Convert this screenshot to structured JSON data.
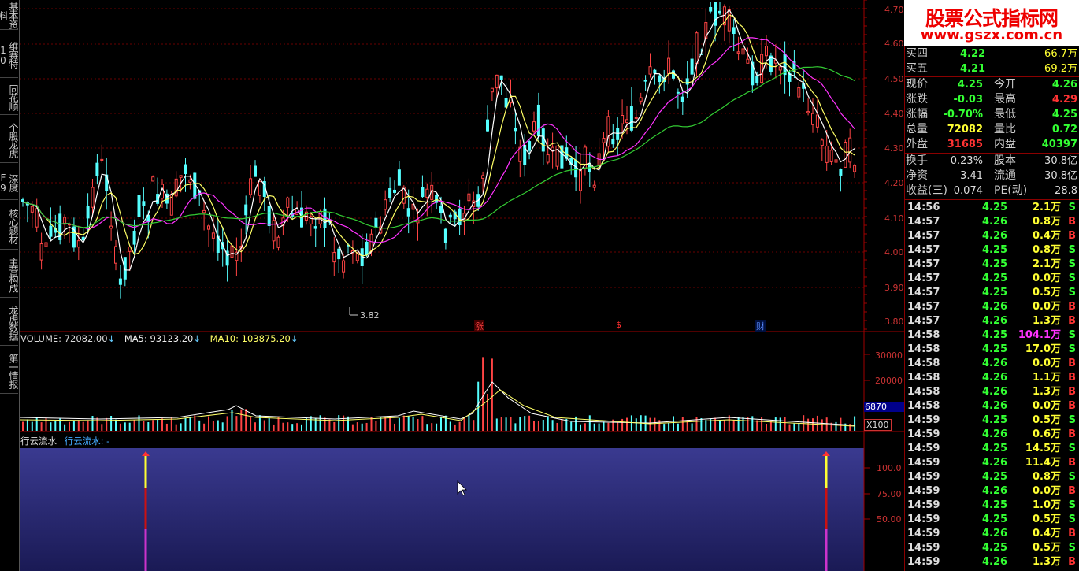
{
  "left_tabs": [
    {
      "label": "基本资料"
    },
    {
      "label": "维赛特10"
    },
    {
      "label": "同花顺"
    },
    {
      "label": "个股龙虎"
    },
    {
      "label": "深度F9"
    },
    {
      "label": "核心题材"
    },
    {
      "label": "主营构成"
    },
    {
      "label": "龙虎数据"
    },
    {
      "label": "第一情报"
    }
  ],
  "logo": {
    "title": "股票公式指标网",
    "url": "www.gszx.com.cn"
  },
  "price_axis": [
    "4.70",
    "4.60",
    "4.50",
    "4.40",
    "4.30",
    "4.20",
    "4.10",
    "4.00",
    "3.90",
    "3.80"
  ],
  "low_marker": "3.82",
  "event_markers": [
    {
      "label": "涨",
      "color": "#ff4444"
    },
    {
      "label": "$",
      "color": "#ff3030"
    },
    {
      "label": "财",
      "color": "#5a8cff"
    }
  ],
  "volume_header": {
    "volume": "VOLUME: 72082.00",
    "ma5": "MA5: 93123.20",
    "ma10": "MA10: 103875.20",
    "arrow": "↓"
  },
  "volume_axis": [
    "30000",
    "20000"
  ],
  "volume_box": "6870",
  "volume_unit": "X100",
  "indicator": {
    "name": "行云流水",
    "label": "行云流水: -"
  },
  "indicator_axis": [
    "100.0",
    "75.00",
    "50.00"
  ],
  "quote": {
    "ask_rows": [
      {
        "label": "买四",
        "price": "4.22",
        "vol": "66.7万"
      },
      {
        "label": "买五",
        "price": "4.21",
        "vol": "69.2万"
      }
    ],
    "stats": [
      {
        "l1": "现价",
        "v1": "4.25",
        "c1": "#33ff33",
        "l2": "今开",
        "v2": "4.26",
        "c2": "#33ff33"
      },
      {
        "l1": "涨跌",
        "v1": "-0.03",
        "c1": "#33ff33",
        "l2": "最高",
        "v2": "4.29",
        "c2": "#ff3333"
      },
      {
        "l1": "涨幅",
        "v1": "-0.70%",
        "c1": "#33ff33",
        "l2": "最低",
        "v2": "4.25",
        "c2": "#33ff33"
      },
      {
        "l1": "总量",
        "v1": "72082",
        "c1": "#ffff33",
        "l2": "量比",
        "v2": "0.72",
        "c2": "#33ff33"
      },
      {
        "l1": "外盘",
        "v1": "31685",
        "c1": "#ff3333",
        "l2": "内盘",
        "v2": "40397",
        "c2": "#33ff33"
      }
    ],
    "fundamentals": [
      {
        "l1": "换手",
        "v1": "0.23%",
        "l2": "股本",
        "v2": "30.8亿"
      },
      {
        "l1": "净资",
        "v1": "3.41",
        "l2": "流通",
        "v2": "30.8亿"
      },
      {
        "l1": "收益(三)",
        "v1": "0.074",
        "l2": "PE(动)",
        "v2": "28.8"
      }
    ]
  },
  "ticks": [
    {
      "t": "14:56",
      "p": "4.25",
      "v": "2.1万",
      "s": "S"
    },
    {
      "t": "14:57",
      "p": "4.26",
      "v": "0.8万",
      "s": "B"
    },
    {
      "t": "14:57",
      "p": "4.26",
      "v": "0.4万",
      "s": "B"
    },
    {
      "t": "14:57",
      "p": "4.25",
      "v": "0.8万",
      "s": "S"
    },
    {
      "t": "14:57",
      "p": "4.25",
      "v": "2.1万",
      "s": "S"
    },
    {
      "t": "14:57",
      "p": "4.25",
      "v": "0.0万",
      "s": "S"
    },
    {
      "t": "14:57",
      "p": "4.25",
      "v": "0.5万",
      "s": "S"
    },
    {
      "t": "14:57",
      "p": "4.26",
      "v": "0.0万",
      "s": "B"
    },
    {
      "t": "14:57",
      "p": "4.26",
      "v": "1.3万",
      "s": "B"
    },
    {
      "t": "14:58",
      "p": "4.25",
      "v": "104.1万",
      "s": "S"
    },
    {
      "t": "14:58",
      "p": "4.25",
      "v": "17.0万",
      "s": "S"
    },
    {
      "t": "14:58",
      "p": "4.26",
      "v": "0.0万",
      "s": "B"
    },
    {
      "t": "14:58",
      "p": "4.26",
      "v": "1.1万",
      "s": "B"
    },
    {
      "t": "14:58",
      "p": "4.26",
      "v": "1.3万",
      "s": "B"
    },
    {
      "t": "14:58",
      "p": "4.26",
      "v": "0.0万",
      "s": "B"
    },
    {
      "t": "14:59",
      "p": "4.25",
      "v": "0.5万",
      "s": "S"
    },
    {
      "t": "14:59",
      "p": "4.26",
      "v": "0.6万",
      "s": "B"
    },
    {
      "t": "14:59",
      "p": "4.25",
      "v": "14.5万",
      "s": "S"
    },
    {
      "t": "14:59",
      "p": "4.26",
      "v": "11.4万",
      "s": "B"
    },
    {
      "t": "14:59",
      "p": "4.25",
      "v": "0.8万",
      "s": "S"
    },
    {
      "t": "14:59",
      "p": "4.26",
      "v": "0.0万",
      "s": "B"
    },
    {
      "t": "14:59",
      "p": "4.25",
      "v": "1.0万",
      "s": "S"
    },
    {
      "t": "14:59",
      "p": "4.25",
      "v": "0.5万",
      "s": "S"
    },
    {
      "t": "14:59",
      "p": "4.26",
      "v": "0.4万",
      "s": "B"
    },
    {
      "t": "14:59",
      "p": "4.25",
      "v": "0.5万",
      "s": "S"
    },
    {
      "t": "14:59",
      "p": "4.26",
      "v": "1.3万",
      "s": "B"
    }
  ]
}
